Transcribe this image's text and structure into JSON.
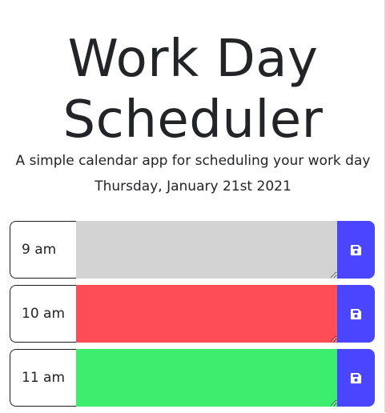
{
  "header": {
    "title_line1": "Work Day",
    "title_line2": "Scheduler",
    "lead": "A simple calendar app for scheduling your work day",
    "current_day": "Thursday, January 21st 2021"
  },
  "rows": [
    {
      "hour": "9 am",
      "status": "past",
      "text": ""
    },
    {
      "hour": "10 am",
      "status": "present",
      "text": ""
    },
    {
      "hour": "11 am",
      "status": "future",
      "text": ""
    }
  ],
  "colors": {
    "past": "#d3d3d3",
    "present": "#ff4d58",
    "future": "#3ded6e",
    "save_button": "#4a46ff"
  },
  "icons": {
    "save": "floppy-disk-icon"
  }
}
